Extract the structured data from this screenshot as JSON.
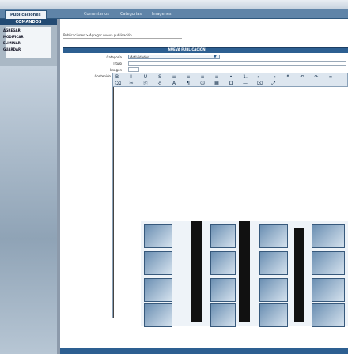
{
  "tabs": [
    {
      "label": "Publicaciones",
      "active": true
    },
    {
      "label": "Comentarios",
      "active": false
    },
    {
      "label": "Categorias",
      "active": false
    },
    {
      "label": "Imagenes",
      "active": false
    }
  ],
  "sidebar": {
    "header": "COMANDOS",
    "items": [
      "AGREGAR",
      "MODIFICAR",
      "ELIMINAR",
      "GUARDAR"
    ]
  },
  "breadcrumb": "Publicaciones > Agregar nueva publicación",
  "form": {
    "section_title": "NUEVA PUBLICACIÓN",
    "category_label": "Categoría",
    "category_value": "Actividades",
    "title_label": "Título",
    "image_label": "Imágen",
    "content_label": "Contenido"
  },
  "toolbar": {
    "row1": [
      "B",
      "I",
      "U",
      "S",
      "≡",
      "≡",
      "≡",
      "≡",
      "•",
      "1.",
      "⇤",
      "⇥",
      "❝",
      "↶",
      "↷",
      "∞"
    ],
    "row2": [
      "⌫",
      "✂",
      "⎘",
      "⎀",
      "A",
      "¶",
      "☺",
      "▦",
      "Ω",
      "—",
      "⌧",
      "⤢"
    ]
  },
  "colors": {
    "accent": "#2d5f91",
    "tab_strip": "#5f84a8",
    "sidebar_bg": "#aab8c5",
    "toolbar_bg": "#dde6ef"
  }
}
